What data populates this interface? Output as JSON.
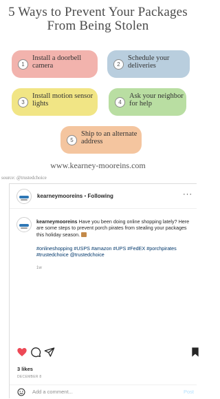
{
  "infographic": {
    "title": "5 Ways to Prevent Your Packages From Being Stolen",
    "tips": [
      {
        "num": "1",
        "text": "Install a doorbell camera",
        "color": "#f2b3ad"
      },
      {
        "num": "2",
        "text": "Schedule your deliveries",
        "color": "#b9cede"
      },
      {
        "num": "3",
        "text": "Install motion sensor lights",
        "color": "#f1e585"
      },
      {
        "num": "4",
        "text": "Ask your neighbor for help",
        "color": "#b9dea2"
      },
      {
        "num": "5",
        "text": "Ship to an alternate address",
        "color": "#f4c59f"
      }
    ],
    "website": "www.kearney-mooreins.com",
    "source": "source: @trustedchoice"
  },
  "post": {
    "username": "kearneymooreins",
    "separator": "•",
    "follow_status": "Following",
    "more_label": "···",
    "caption_user": "kearneymooreins",
    "caption_text": "Have you been doing online shopping lately? Here are some steps to prevent porch pirates from stealing your packages this holiday season.",
    "hashtags": "#onlineshopping #USPS #amazon #UPS #FedEX #porchpirates #trustedchoice @trustedchoice",
    "age": "1w",
    "likes": "3 likes",
    "date": "DECEMBER 8",
    "comment_placeholder": "Add a comment...",
    "post_label": "Post",
    "colors": {
      "like": "#ed4956",
      "link": "#00376b",
      "post_button": "#b2dffc"
    }
  }
}
